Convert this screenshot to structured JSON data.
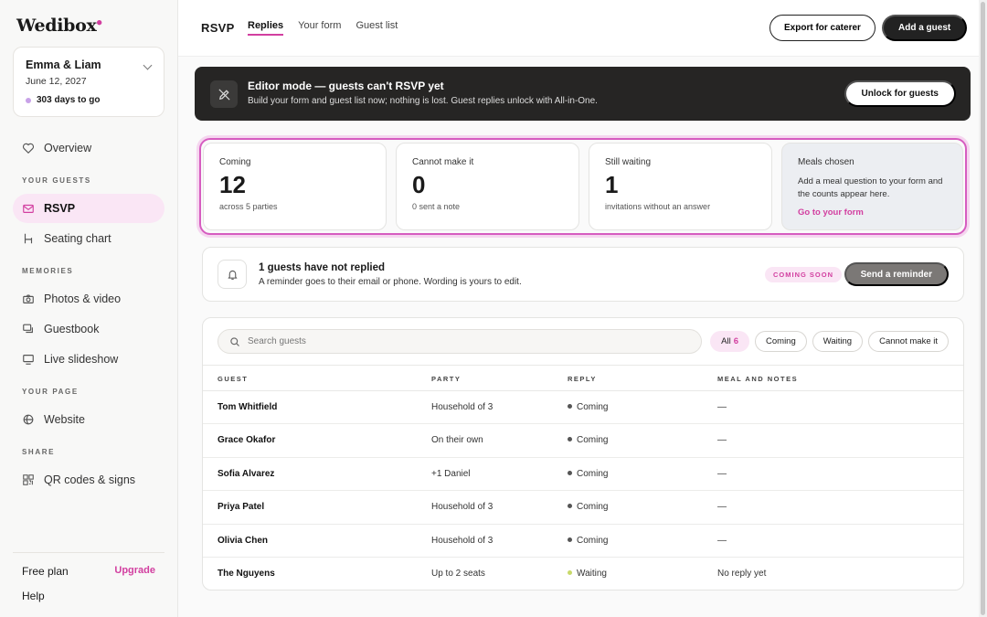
{
  "app": {
    "logo": "Wedibox"
  },
  "event": {
    "couple": "Emma & Liam",
    "date": "June 12, 2027",
    "countdown": "303 days to go"
  },
  "sidebar": {
    "overview": "Overview",
    "sections": {
      "guests": "YOUR GUESTS",
      "memories": "MEMORIES",
      "page": "YOUR PAGE",
      "share": "SHARE"
    },
    "guests_items": [
      "RSVP",
      "Seating chart"
    ],
    "memories_items": [
      "Photos & video",
      "Guestbook",
      "Live slideshow"
    ],
    "page_items": [
      "Website"
    ],
    "share_items": [
      "QR codes & signs"
    ],
    "plan": "Free plan",
    "upgrade": "Upgrade",
    "help": "Help"
  },
  "header": {
    "title": "RSVP",
    "tabs": [
      "Replies",
      "Your form",
      "Guest list"
    ],
    "export_btn": "Export for caterer",
    "add_btn": "Add a guest"
  },
  "banner": {
    "title": "Editor mode — guests can't RSVP yet",
    "subtitle": "Build your form and guest list now; nothing is lost. Guest replies unlock with All-in-One.",
    "button": "Unlock for guests"
  },
  "stats": {
    "coming": {
      "label": "Coming",
      "value": "12",
      "sub": "across 5 parties"
    },
    "cannot": {
      "label": "Cannot make it",
      "value": "0",
      "sub": "0 sent a note"
    },
    "waiting": {
      "label": "Still waiting",
      "value": "1",
      "sub": "invitations without an answer"
    },
    "meals": {
      "label": "Meals chosen",
      "text": "Add a meal question to your form and the counts appear here.",
      "link": "Go to your form"
    }
  },
  "reminder": {
    "title": "1 guests have not replied",
    "subtitle": "A reminder goes to their email or phone. Wording is yours to edit.",
    "badge": "COMING SOON",
    "button": "Send a reminder"
  },
  "guests": {
    "search_placeholder": "Search guests",
    "filters": {
      "all": "All",
      "all_count": "6",
      "coming": "Coming",
      "waiting": "Waiting",
      "cannot": "Cannot make it"
    },
    "columns": [
      "GUEST",
      "PARTY",
      "REPLY",
      "MEAL AND NOTES"
    ],
    "rows": [
      {
        "name": "Tom Whitfield",
        "party": "Household of 3",
        "reply": "Coming",
        "notes": "—"
      },
      {
        "name": "Grace Okafor",
        "party": "On their own",
        "reply": "Coming",
        "notes": "—"
      },
      {
        "name": "Sofia Alvarez",
        "party": "+1 Daniel",
        "reply": "Coming",
        "notes": "—"
      },
      {
        "name": "Priya Patel",
        "party": "Household of 3",
        "reply": "Coming",
        "notes": "—"
      },
      {
        "name": "Olivia Chen",
        "party": "Household of 3",
        "reply": "Coming",
        "notes": "—"
      },
      {
        "name": "The Nguyens",
        "party": "Up to 2 seats",
        "reply": "Waiting",
        "notes": "No reply yet"
      }
    ]
  },
  "colors": {
    "accent": "#d23fa0",
    "coming": "#555555",
    "waiting": "#c8d96a"
  }
}
